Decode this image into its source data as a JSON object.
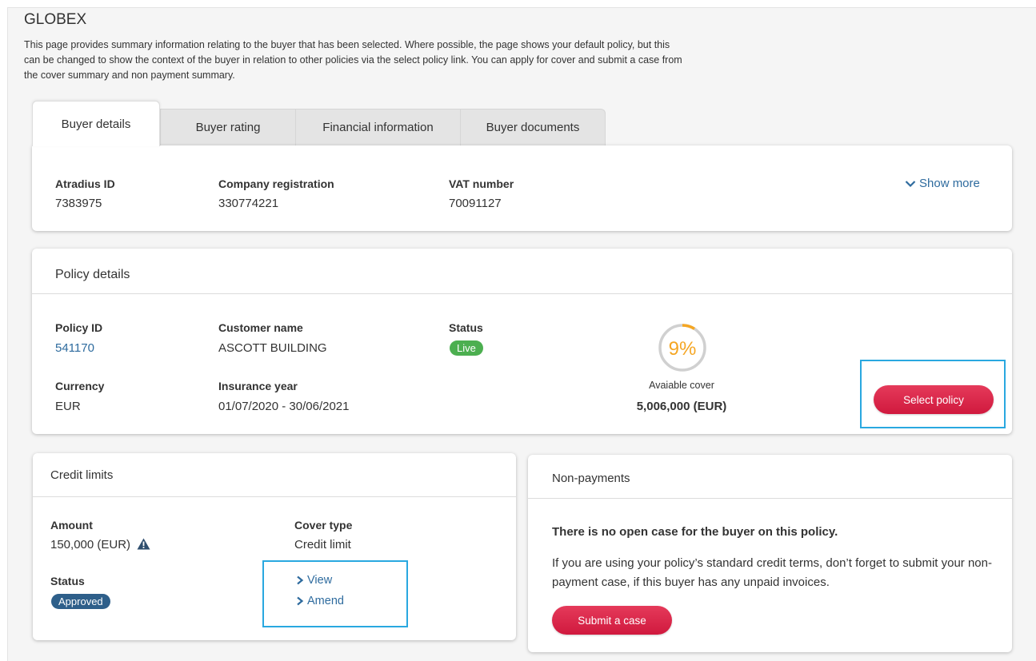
{
  "page": {
    "title": "GLOBEX",
    "intro": "This page provides summary information relating to the buyer that has been selected. Where possible, the page shows your default policy, but this can be changed to show the context of the buyer in relation to other policies via the select policy link. You can apply for cover and submit a case from the cover summary and non payment summary."
  },
  "tabs": [
    {
      "label": "Buyer details",
      "active": true
    },
    {
      "label": "Buyer rating"
    },
    {
      "label": "Financial information"
    },
    {
      "label": "Buyer documents"
    }
  ],
  "buyer": {
    "atradius_id_label": "Atradius ID",
    "atradius_id": "7383975",
    "company_reg_label": "Company registration",
    "company_reg": "330774221",
    "vat_label": "VAT number",
    "vat": "70091127",
    "show_more": "Show more"
  },
  "policy": {
    "header": "Policy details",
    "policy_id_label": "Policy ID",
    "policy_id": "541170",
    "customer_label": "Customer name",
    "customer": "ASCOTT BUILDING",
    "status_label": "Status",
    "status": "Live",
    "currency_label": "Currency",
    "currency": "EUR",
    "year_label": "Insurance year",
    "year": "01/07/2020 - 30/06/2021",
    "cover_percent_text": "9%",
    "cover_percent": 9,
    "cover_label": "Avaiable cover",
    "cover_amount": "5,006,000 (EUR)",
    "select_button": "Select policy"
  },
  "credit": {
    "header": "Credit limits",
    "amount_label": "Amount",
    "amount": "150,000 (EUR)",
    "cover_type_label": "Cover type",
    "cover_type": "Credit limit",
    "status_label": "Status",
    "status": "Approved",
    "view": "View",
    "amend": "Amend"
  },
  "nonpay": {
    "header": "Non-payments",
    "headline": "There is no open case for the buyer on this policy.",
    "body": "If you are using your policy’s standard credit terms, don’t forget to submit your non-payment case, if this buyer has any unpaid invoices.",
    "button": "Submit a case"
  },
  "colors": {
    "accent": "#d0193e",
    "link": "#2e6b9e",
    "live": "#4caf50",
    "approved": "#2e5f8a",
    "gauge": "#f5a623",
    "highlight": "#29a8e0"
  },
  "icons": {
    "show_more": "chevron-down-icon",
    "warning": "warning-triangle-icon",
    "link_chevron": "chevron-right-icon"
  }
}
